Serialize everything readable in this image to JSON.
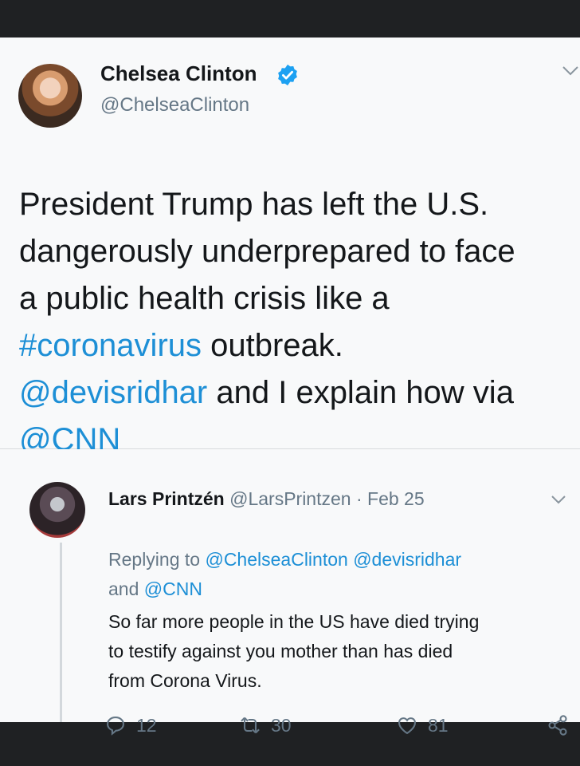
{
  "main_tweet": {
    "name": "Chelsea Clinton",
    "handle": "@ChelseaClinton",
    "text": {
      "line1": "President Trump has left the U.S.",
      "line2": "dangerously underprepared to face",
      "line3": "a public health crisis like a",
      "hashtag": "#coronavirus",
      "line4_rest": " outbreak.",
      "mention1": "@devisridhar",
      "line5_rest": " and I explain how via",
      "mention2": "@CNN"
    }
  },
  "reply_tweet": {
    "name": "Lars Printzén",
    "meta": " @LarsPrintzen · Feb 25",
    "replying_prefix": "Replying to ",
    "replying_handle1": "@ChelseaClinton",
    "replying_space": " ",
    "replying_handle2": "@devisridhar",
    "replying_and": "and ",
    "replying_handle3": "@CNN",
    "text_line1": "So far more people in the US have died trying",
    "text_line2": "to testify against you mother than has died",
    "text_line3": "from Corona Virus.",
    "replies": "12",
    "retweets": "30",
    "likes": "81"
  },
  "colors": {
    "link": "#1d8fd6",
    "verified": "#1da1f2",
    "secondary_text": "#657786"
  },
  "icons": [
    "verified-badge-icon",
    "chevron-down-icon",
    "reply-icon",
    "retweet-icon",
    "like-icon",
    "share-icon"
  ]
}
